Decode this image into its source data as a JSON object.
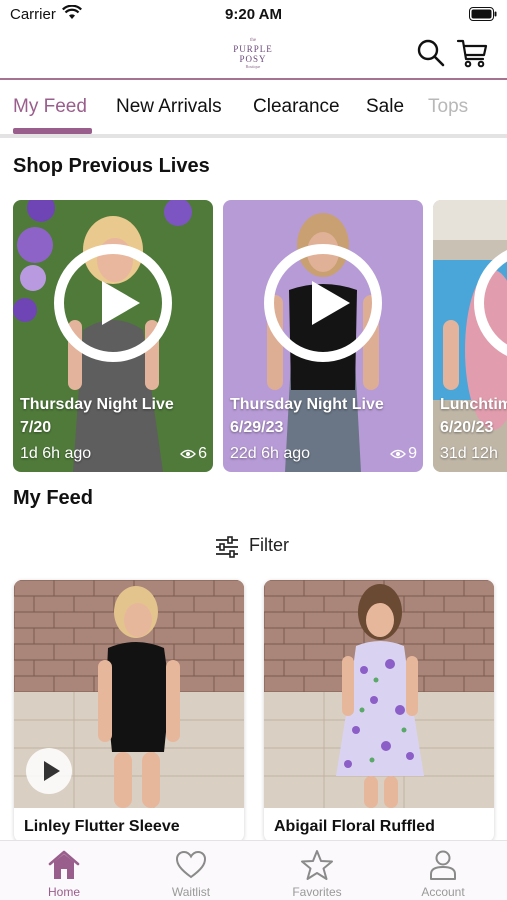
{
  "status_bar": {
    "carrier": "Carrier",
    "time": "9:20 AM"
  },
  "header": {
    "logo": {
      "small": "the",
      "line1": "PURPLE",
      "line2": "POSY",
      "sub": "Boutique"
    }
  },
  "tabs": [
    {
      "label": "My Feed",
      "active": true
    },
    {
      "label": "New Arrivals",
      "active": false
    },
    {
      "label": "Clearance",
      "active": false
    },
    {
      "label": "Sale",
      "active": false
    },
    {
      "label": "Tops",
      "active": false
    }
  ],
  "sections": {
    "shop_previous_lives": "Shop Previous Lives",
    "my_feed": "My Feed"
  },
  "lives": [
    {
      "title": "Thursday Night Live",
      "date": "7/20",
      "ago": "1d 6h ago",
      "views": "6"
    },
    {
      "title": "Thursday Night Live",
      "date": "6/29/23",
      "ago": "22d 6h ago",
      "views": "9"
    },
    {
      "title": "Lunchtime",
      "date": "6/20/23",
      "ago": "31d 12h"
    }
  ],
  "filter": {
    "label": "Filter"
  },
  "products": [
    {
      "name": "Linley Flutter Sleeve",
      "has_video": true
    },
    {
      "name": "Abigail Floral Ruffled",
      "has_video": false
    }
  ],
  "bottom_nav": [
    {
      "label": "Home",
      "icon": "home-icon",
      "active": true
    },
    {
      "label": "Waitlist",
      "icon": "heart-icon",
      "active": false
    },
    {
      "label": "Favorites",
      "icon": "star-icon",
      "active": false
    },
    {
      "label": "Account",
      "icon": "person-icon",
      "active": false
    }
  ],
  "colors": {
    "accent": "#9a5e8c",
    "header_border": "#a3738f"
  }
}
